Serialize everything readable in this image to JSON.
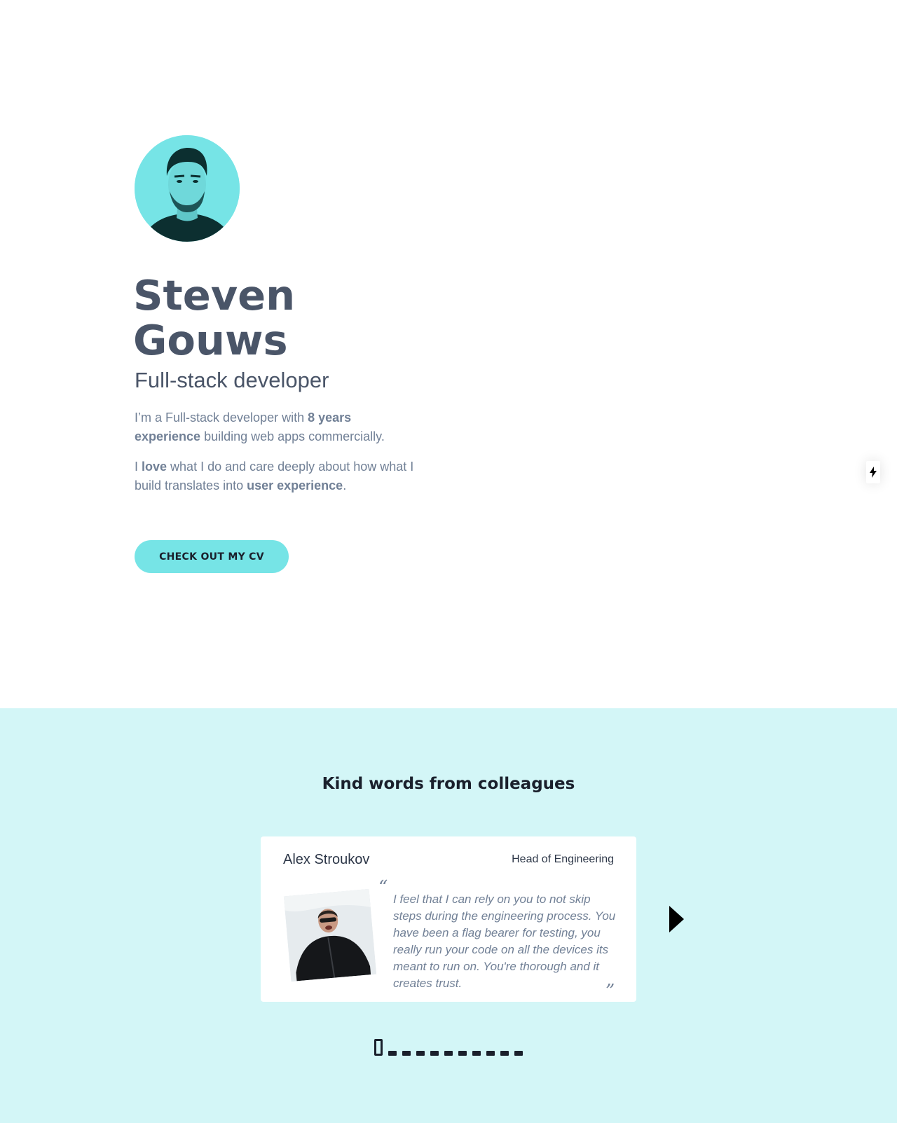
{
  "hero": {
    "name_line1": "Steven",
    "name_line2": "Gouws",
    "role": "Full-stack developer",
    "bio1": {
      "t1": "I’m a Full-stack developer with ",
      "b1": "8 years experience",
      "t2": " building web apps commercially."
    },
    "bio2": {
      "t1": "I ",
      "b1": "love",
      "t2": " what I do and care deeply about how what I build translates into ",
      "b2": "user experience",
      "t3": "."
    },
    "cv_button": "CHECK OUT MY CV"
  },
  "side_tab": {
    "icon": "lightning-icon"
  },
  "testimonials": {
    "title": "Kind words from colleagues",
    "card": {
      "name": "Alex Stroukov",
      "job_title": "Head of Engineering",
      "quote_open": "“",
      "quote": "I feel that I can rely on you to not skip steps during the engineering process. You have been a flag bearer for testing, you really run your code on all the devices its meant to run on. You're thorough and it creates trust.",
      "quote_close": "”"
    },
    "dot_count": 11,
    "active_dot": 0
  },
  "colors": {
    "accent": "#76e4e6",
    "section_bg": "#d3f6f7",
    "text_dark": "#4a5568",
    "text_muted": "#718096"
  }
}
